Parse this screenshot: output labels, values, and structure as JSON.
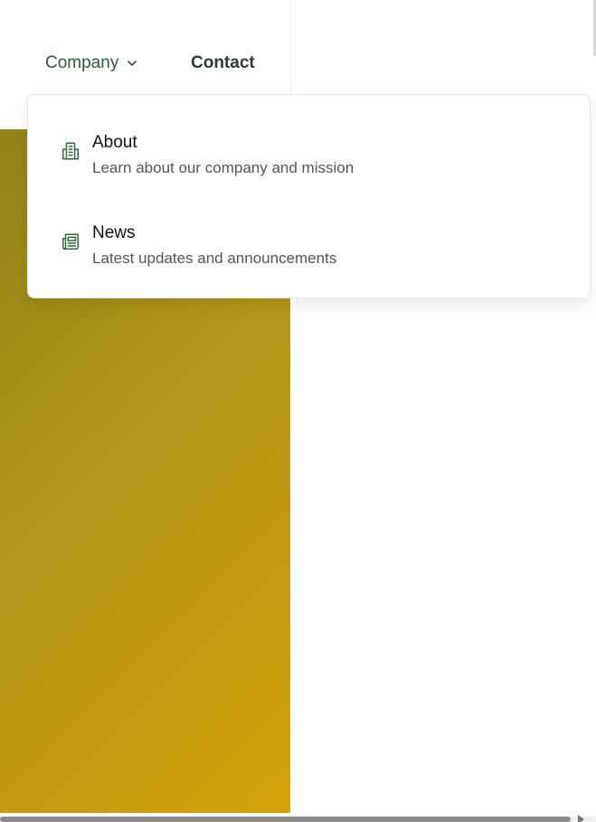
{
  "nav": {
    "company_label": "Company",
    "company_icon": "chevron-down-icon",
    "contact_label": "Contact"
  },
  "dropdown": {
    "items": [
      {
        "title": "About",
        "description": "Learn about our company and mission",
        "icon": "building-icon"
      },
      {
        "title": "News",
        "description": "Latest updates and announcements",
        "icon": "newspaper-icon"
      }
    ]
  },
  "colors": {
    "nav_active": "#2f5a3a",
    "nav_text": "#2e3b3a",
    "icon": "#2f6a3a",
    "hero_gradient_start": "#8f8418",
    "hero_gradient_end": "#d6a208"
  }
}
